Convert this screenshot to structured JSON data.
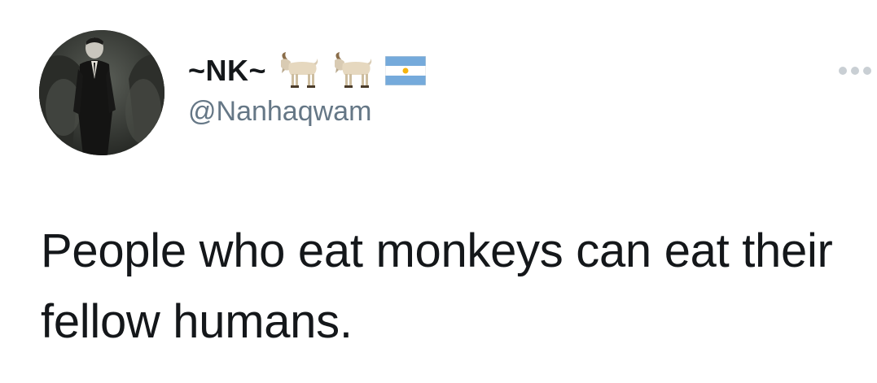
{
  "author": {
    "display_name": "~NK~",
    "name_emojis": [
      "goat-emoji",
      "goat-emoji",
      "argentina-flag-emoji"
    ],
    "handle": "@Nanhaqwam",
    "avatar": "grayscale-photo-man-in-suit"
  },
  "menu": {
    "icon": "more-options-icon"
  },
  "tweet": {
    "text": "People who eat monkeys can eat their fellow humans."
  },
  "colors": {
    "text": "#14171a",
    "secondary": "#657786",
    "background": "#ffffff"
  }
}
